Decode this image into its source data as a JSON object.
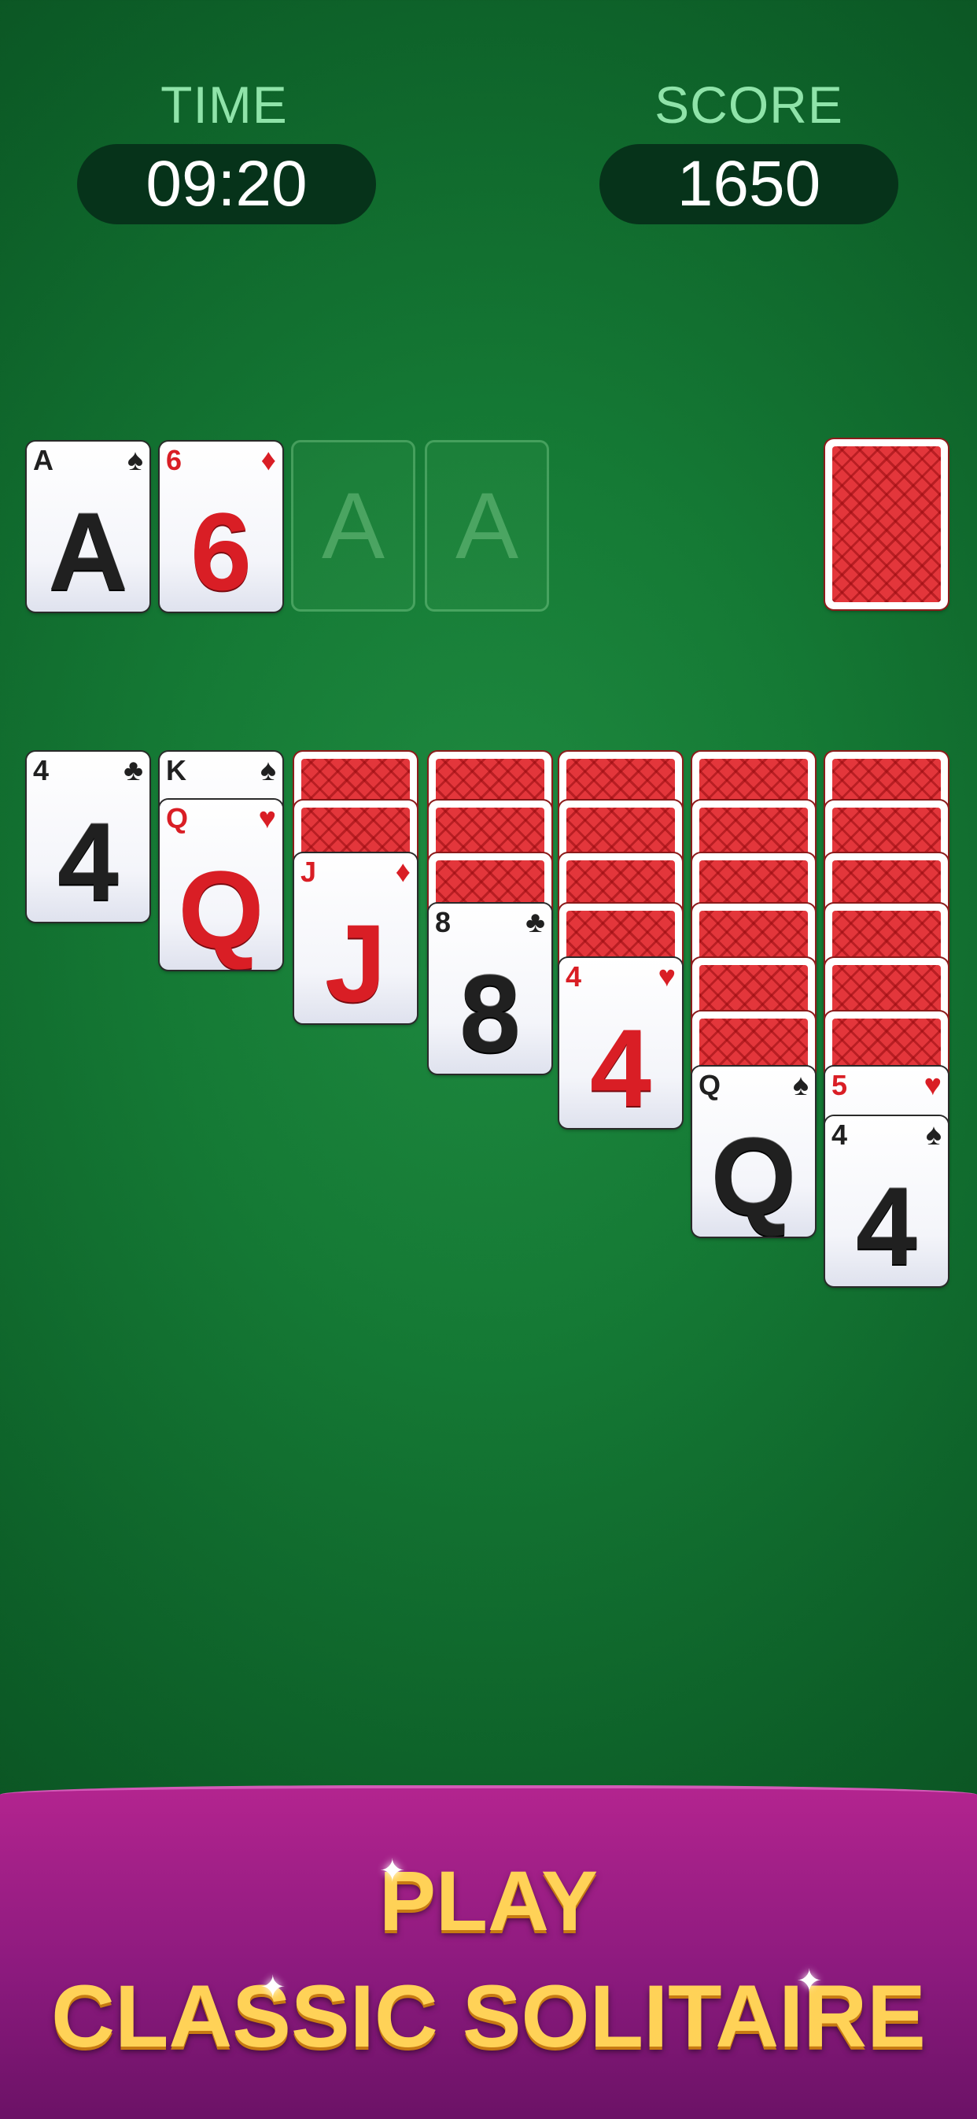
{
  "hud": {
    "time_label": "TIME",
    "time_value": "09:20",
    "score_label": "SCORE",
    "score_value": "1650"
  },
  "top_row": {
    "waste": [
      {
        "rank": "A",
        "suit": "♠",
        "color": "black"
      },
      {
        "rank": "6",
        "suit": "♦",
        "color": "red"
      }
    ],
    "foundations": [
      {
        "label": "A"
      },
      {
        "label": "A"
      }
    ],
    "stock": {
      "face": "down"
    }
  },
  "tableau": [
    {
      "face_down": 0,
      "cards": [
        {
          "rank": "4",
          "suit": "♣",
          "color": "black"
        }
      ]
    },
    {
      "face_down": 0,
      "cards": [
        {
          "rank": "K",
          "suit": "♠",
          "color": "black"
        },
        {
          "rank": "Q",
          "suit": "♥",
          "color": "red"
        }
      ]
    },
    {
      "face_down": 2,
      "cards": [
        {
          "rank": "J",
          "suit": "♦",
          "color": "red"
        }
      ]
    },
    {
      "face_down": 3,
      "cards": [
        {
          "rank": "8",
          "suit": "♣",
          "color": "black"
        }
      ]
    },
    {
      "face_down": 4,
      "cards": [
        {
          "rank": "4",
          "suit": "♥",
          "color": "red"
        }
      ]
    },
    {
      "face_down": 6,
      "cards": [
        {
          "rank": "Q",
          "suit": "♠",
          "color": "black"
        }
      ]
    },
    {
      "face_down": 6,
      "cards": [
        {
          "rank": "5",
          "suit": "♥",
          "color": "red"
        },
        {
          "rank": "4",
          "suit": "♠",
          "color": "black"
        }
      ]
    }
  ],
  "banner": {
    "line1": "PLAY",
    "line2": "CLASSIC SOLITAIRE"
  },
  "colors": {
    "felt": "#157a35",
    "red_suit": "#d91e25",
    "banner": "#a1207f",
    "banner_text": "#ffd257"
  }
}
